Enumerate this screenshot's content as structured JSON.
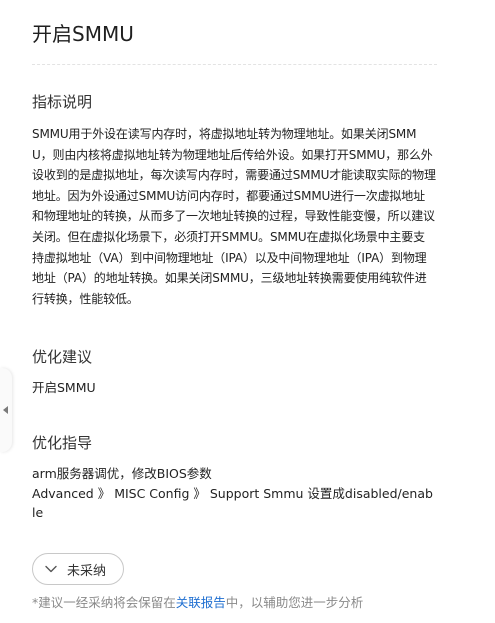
{
  "page": {
    "title": "开启SMMU"
  },
  "sections": {
    "description": {
      "heading": "指标说明",
      "text": "SMMU用于外设在读写内存时，将虚拟地址转为物理地址。如果关闭SMMU，则由内核将虚拟地址转为物理地址后传给外设。如果打开SMMU，那么外设收到的是虚拟地址，每次读写内存时，需要通过SMMU才能读取实际的物理地址。因为外设通过SMMU访问内存时，都要通过SMMU进行一次虚拟地址和物理地址的转换，从而多了一次地址转换的过程，导致性能变慢，所以建议关闭。但在虚拟化场景下，必须打开SMMU。SMMU在虚拟化场景中主要支持虚拟地址（VA）到中间物理地址（IPA）以及中间物理地址（IPA）到物理地址（PA）的地址转换。如果关闭SMMU，三级地址转换需要使用纯软件进行转换，性能较低。"
    },
    "suggestion": {
      "heading": "优化建议",
      "text": "开启SMMU"
    },
    "guide": {
      "heading": "优化指导",
      "line1": "arm服务器调优，修改BIOS参数",
      "line2": "Advanced 》 MISC Config 》 Support Smmu 设置成disabled/enable"
    }
  },
  "status_button": {
    "label": "未采纳",
    "icon": "chevron-down-icon"
  },
  "footnote": {
    "prefix": "*建议一经采纳将会保留在",
    "link": "关联报告",
    "suffix": "中，以辅助您进一步分析"
  },
  "side_panel": {
    "icon": "caret-left-icon"
  },
  "colors": {
    "link": "#1f6fd1",
    "muted_text": "#8a8a8a",
    "border": "#c8c8c8"
  }
}
